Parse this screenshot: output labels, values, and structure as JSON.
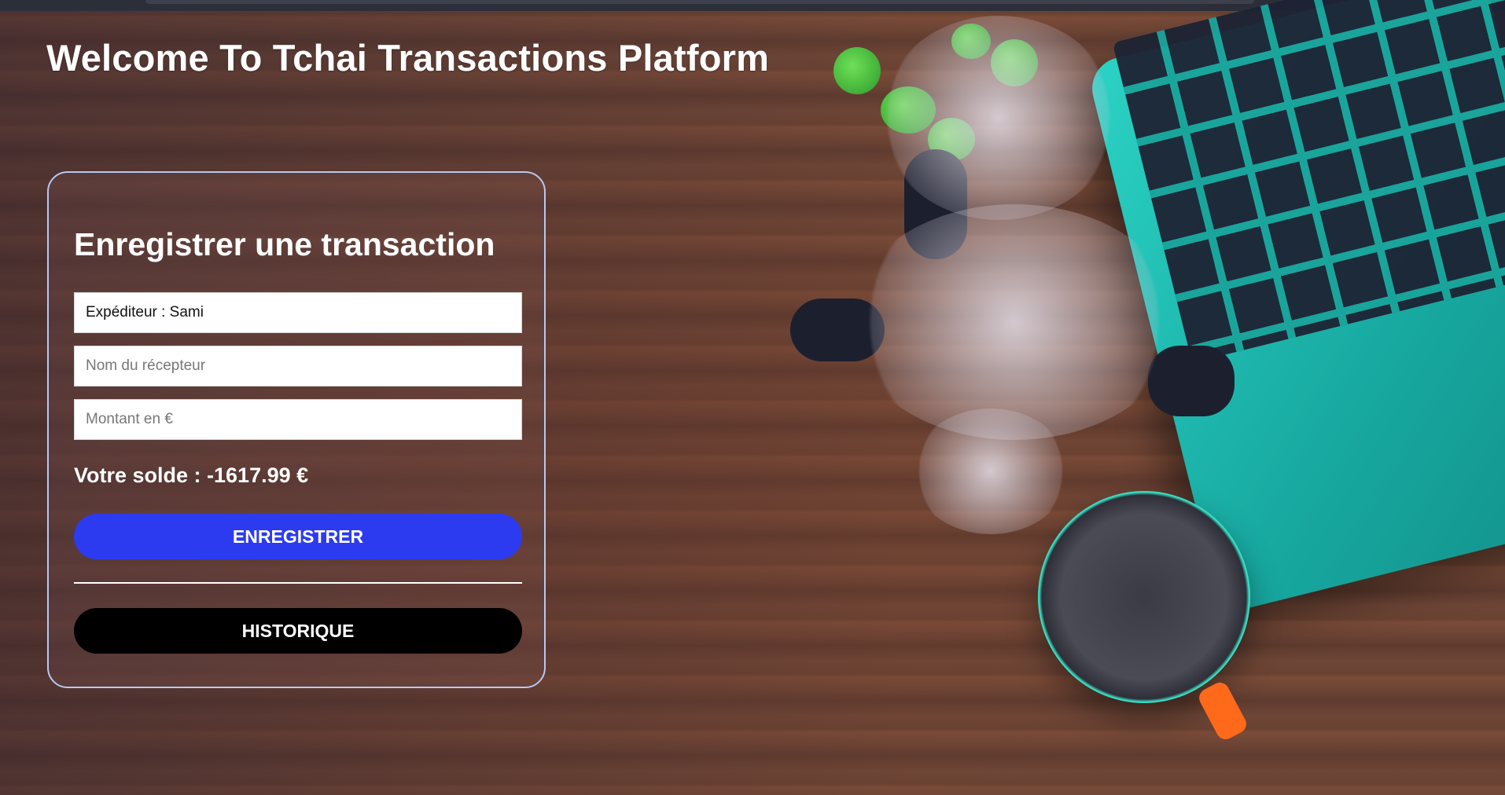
{
  "page": {
    "title": "Welcome To Tchai Transactions Platform"
  },
  "form": {
    "title": "Enregistrer une transaction",
    "sender_value": "Expéditeur : Sami",
    "receiver_placeholder": "Nom du récepteur",
    "amount_placeholder": "Montant en €",
    "balance_text": "Votre solde : -1617.99 €",
    "save_label": "ENREGISTRER",
    "history_label": "HISTORIQUE"
  },
  "colors": {
    "save_button": "#2c3bf0",
    "history_button": "#000000",
    "card_border": "#b8c8f0"
  }
}
